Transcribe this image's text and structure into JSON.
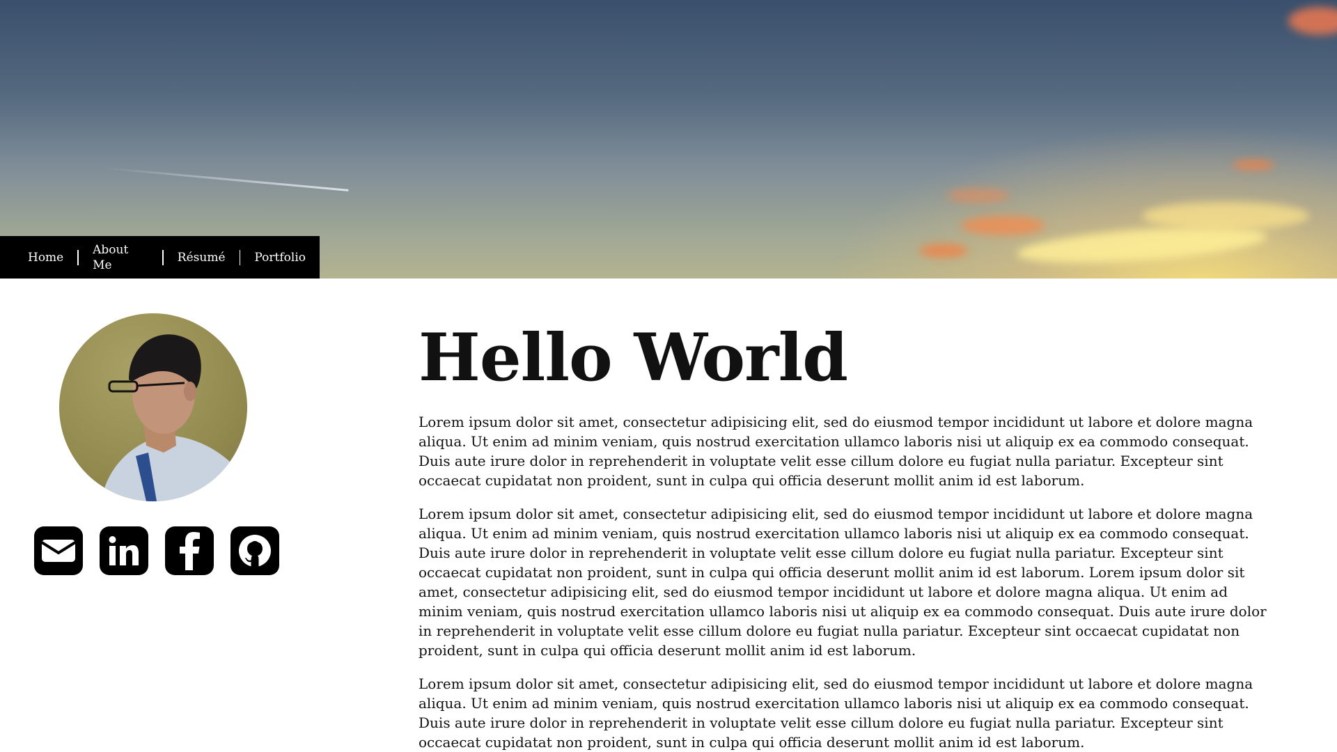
{
  "nav": {
    "items": [
      {
        "label": "Home"
      },
      {
        "label": "About Me"
      },
      {
        "label": "Résumé"
      },
      {
        "label": "Portfolio"
      }
    ]
  },
  "sidebar": {
    "avatar": "profile-photo",
    "social": [
      {
        "icon": "envelope-icon"
      },
      {
        "icon": "linkedin-icon"
      },
      {
        "icon": "facebook-icon"
      },
      {
        "icon": "github-icon"
      }
    ]
  },
  "main": {
    "title": "Hello World",
    "paragraphs": [
      "Lorem ipsum dolor sit amet, consectetur adipisicing elit, sed do eiusmod tempor incididunt ut labore et dolore magna aliqua. Ut enim ad minim veniam, quis nostrud exercitation ullamco laboris nisi ut aliquip ex ea commodo consequat. Duis aute irure dolor in reprehenderit in voluptate velit esse cillum dolore eu fugiat nulla pariatur. Excepteur sint occaecat cupidatat non proident, sunt in culpa qui officia deserunt mollit anim id est laborum.",
      "Lorem ipsum dolor sit amet, consectetur adipisicing elit, sed do eiusmod tempor incididunt ut labore et dolore magna aliqua. Ut enim ad minim veniam, quis nostrud exercitation ullamco laboris nisi ut aliquip ex ea commodo consequat. Duis aute irure dolor in reprehenderit in voluptate velit esse cillum dolore eu fugiat nulla pariatur. Excepteur sint occaecat cupidatat non proident, sunt in culpa qui officia deserunt mollit anim id est laborum. Lorem ipsum dolor sit amet, consectetur adipisicing elit, sed do eiusmod tempor incididunt ut labore et dolore magna aliqua. Ut enim ad minim veniam, quis nostrud exercitation ullamco laboris nisi ut aliquip ex ea commodo consequat. Duis aute irure dolor in reprehenderit in voluptate velit esse cillum dolore eu fugiat nulla pariatur. Excepteur sint occaecat cupidatat non proident, sunt in culpa qui officia deserunt mollit anim id est laborum.",
      "Lorem ipsum dolor sit amet, consectetur adipisicing elit, sed do eiusmod tempor incididunt ut labore et dolore magna aliqua. Ut enim ad minim veniam, quis nostrud exercitation ullamco laboris nisi ut aliquip ex ea commodo consequat. Duis aute irure dolor in reprehenderit in voluptate velit esse cillum dolore eu fugiat nulla pariatur. Excepteur sint occaecat cupidatat non proident, sunt in culpa qui officia deserunt mollit anim id est laborum."
    ]
  }
}
